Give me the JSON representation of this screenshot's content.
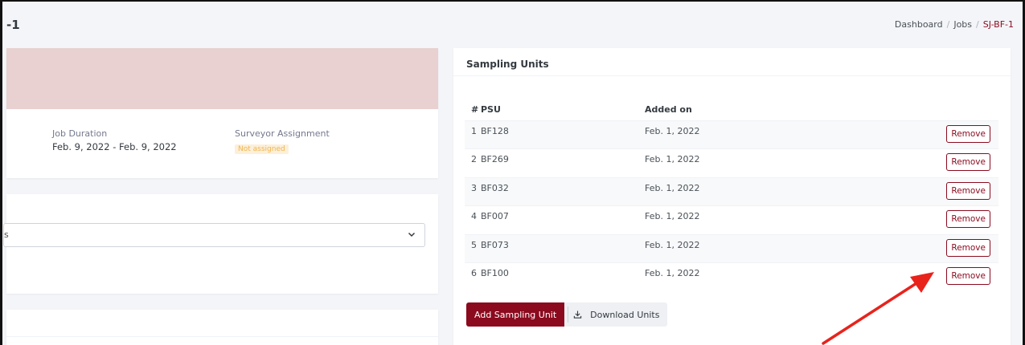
{
  "header": {
    "title": "-1",
    "breadcrumb": [
      "Dashboard",
      "Jobs",
      "SJ-BF-1"
    ],
    "breadcrumb_sep": "/"
  },
  "job": {
    "duration_label": "Job Duration",
    "duration_value": "Feb. 9, 2022 - Feb. 9, 2022",
    "assignment_label": "Surveyor Assignment",
    "assignment_value": "Not assigned"
  },
  "select": {
    "value": "s"
  },
  "units": {
    "title": "Sampling Units",
    "columns": [
      "#",
      "PSU",
      "Added on"
    ],
    "rows": [
      {
        "n": "1",
        "psu": "BF128",
        "added": "Feb. 1, 2022",
        "action": "Remove"
      },
      {
        "n": "2",
        "psu": "BF269",
        "added": "Feb. 1, 2022",
        "action": "Remove"
      },
      {
        "n": "3",
        "psu": "BF032",
        "added": "Feb. 1, 2022",
        "action": "Remove"
      },
      {
        "n": "4",
        "psu": "BF007",
        "added": "Feb. 1, 2022",
        "action": "Remove"
      },
      {
        "n": "5",
        "psu": "BF073",
        "added": "Feb. 1, 2022",
        "action": "Remove"
      },
      {
        "n": "6",
        "psu": "BF100",
        "added": "Feb. 1, 2022",
        "action": "Remove"
      }
    ],
    "add_button": "Add Sampling Unit",
    "download_button": "Download Units",
    "download_icon": "download-icon"
  },
  "colors": {
    "brand": "#8b0a1e",
    "banner": "#e8d1d0",
    "warning": "#f1b44c",
    "annotation_arrow": "#e8231c"
  }
}
